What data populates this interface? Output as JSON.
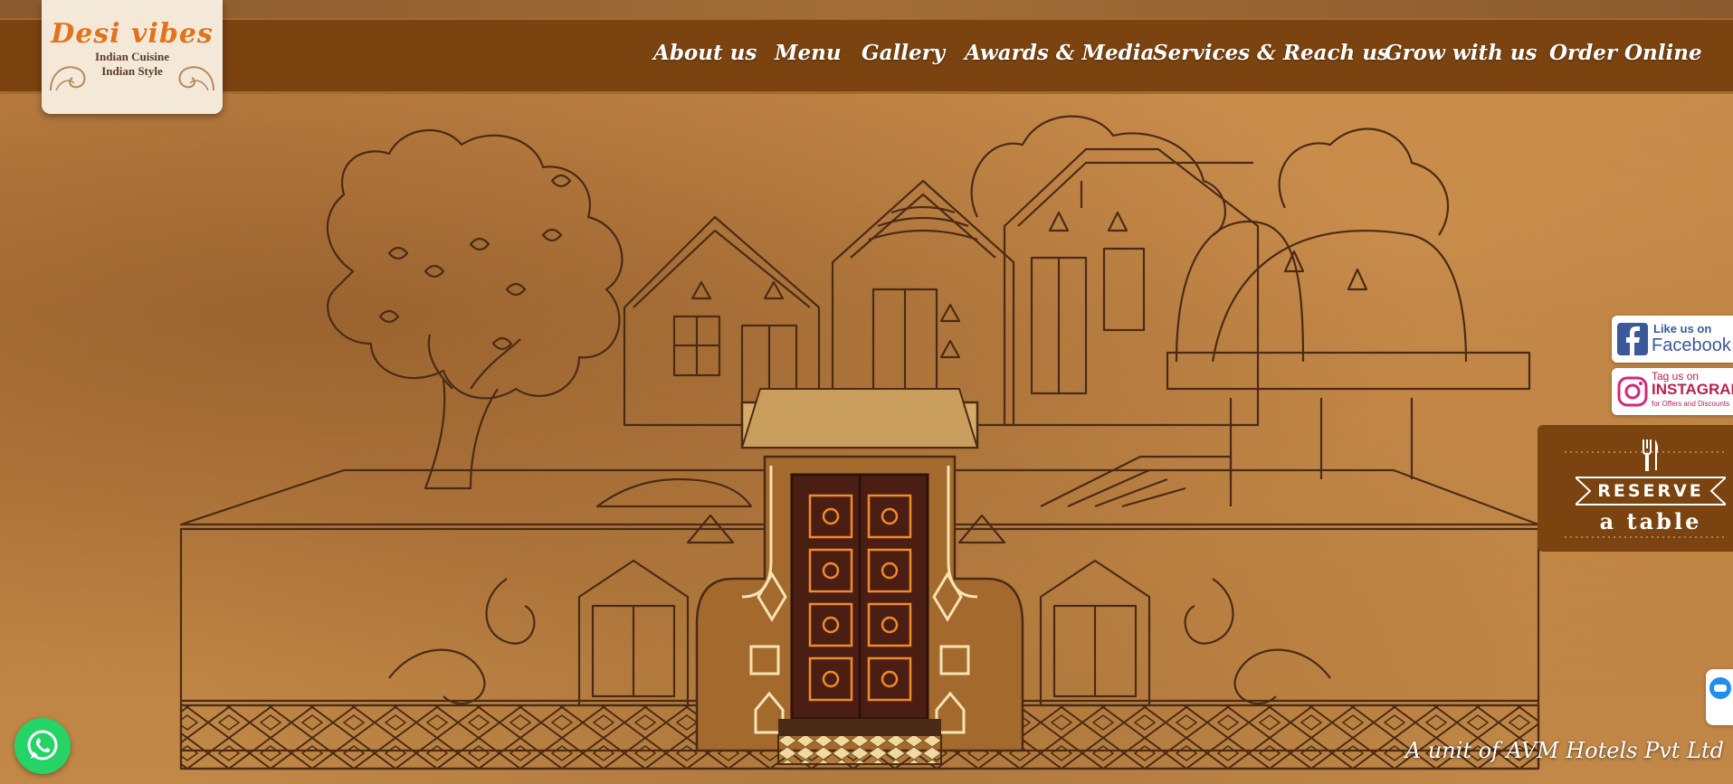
{
  "logo": {
    "title": "Desi vibes",
    "line1": "Indian Cuisine",
    "line2": "Indian Style"
  },
  "nav": {
    "items": [
      {
        "label": "About us"
      },
      {
        "label": "Menu"
      },
      {
        "label": "Gallery"
      },
      {
        "label": "Awards & Media"
      },
      {
        "label": "Services & Reach us"
      },
      {
        "label": "Grow with us"
      },
      {
        "label": "Order Online"
      }
    ]
  },
  "social": {
    "facebook_small": "Like us on",
    "facebook_big": "Facebook",
    "instagram_small": "Tag us on",
    "instagram_big": "INSTAGRAM",
    "instagram_note": "for Offers and Discounts"
  },
  "reserve": {
    "line1": "RESERVE",
    "line2": "a table"
  },
  "footer": {
    "note": "A unit of AVM Hotels Pvt Ltd"
  },
  "icons": {
    "whatsapp": "whatsapp-icon",
    "cutlery": "cutlery-icon",
    "chat": "chat-icon",
    "facebook": "facebook-icon",
    "instagram": "instagram-icon"
  },
  "colors": {
    "nav_bg": "#7a430f",
    "logo_text": "#e2731c",
    "background": "#b57a3c",
    "whatsapp": "#25d366"
  }
}
